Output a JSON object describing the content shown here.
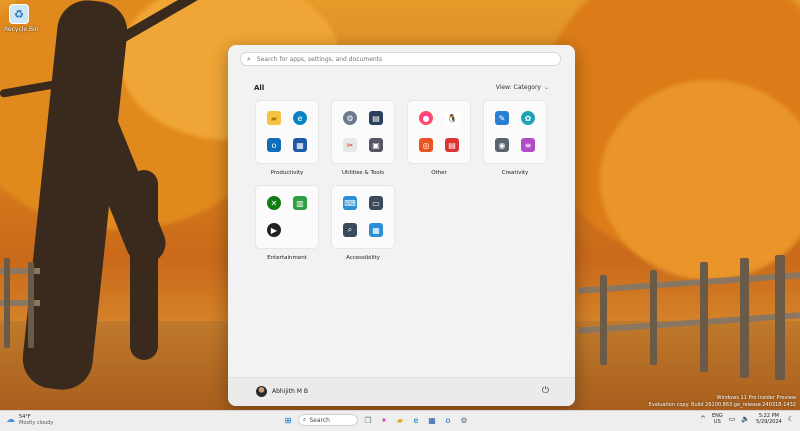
{
  "desktop": {
    "icon_label": "Recycle Bin",
    "icon": "recycle-bin-icon"
  },
  "start_menu": {
    "search_placeholder": "Search for apps, settings, and documents",
    "section_label": "All",
    "view_label": "View: Category",
    "categories": [
      {
        "label": "Productivity",
        "apps": [
          "file-explorer-icon",
          "edge-icon",
          "outlook-icon",
          "store-icon"
        ]
      },
      {
        "label": "Utilities & Tools",
        "apps": [
          "settings-icon",
          "calculator-icon",
          "snipping-tool-icon",
          "control-panel-icon"
        ]
      },
      {
        "label": "Other",
        "apps": [
          "copilot-icon",
          "linux-icon",
          "ubuntu-icon",
          "news-icon"
        ]
      },
      {
        "label": "Creativity",
        "apps": [
          "paint-icon",
          "photos-icon",
          "camera-icon",
          "clipchamp-icon"
        ]
      },
      {
        "label": "Entertainment",
        "apps": [
          "xbox-icon",
          "solitaire-icon",
          "media-player-icon"
        ]
      },
      {
        "label": "Accessibility",
        "apps": [
          "on-screen-keyboard-icon",
          "narrator-icon",
          "magnifier-icon",
          "voice-access-icon"
        ]
      }
    ],
    "user_name": "Abhijith M B"
  },
  "watermark": {
    "line1": "Windows 11 Pro Insider Preview",
    "line2": "Evaluation copy. Build 26100.863 ge_release.240318-1432"
  },
  "taskbar": {
    "weather_temp": "54°F",
    "weather_desc": "Mostly cloudy",
    "search_label": "Search",
    "lang_top": "ENG",
    "lang_bottom": "US",
    "time": "5:22 PM",
    "date": "5/29/2024"
  },
  "colors": {
    "accent": "#0067c0",
    "menu_bg": "#f2f2f2",
    "taskbar_bg": "#eeeeee"
  }
}
